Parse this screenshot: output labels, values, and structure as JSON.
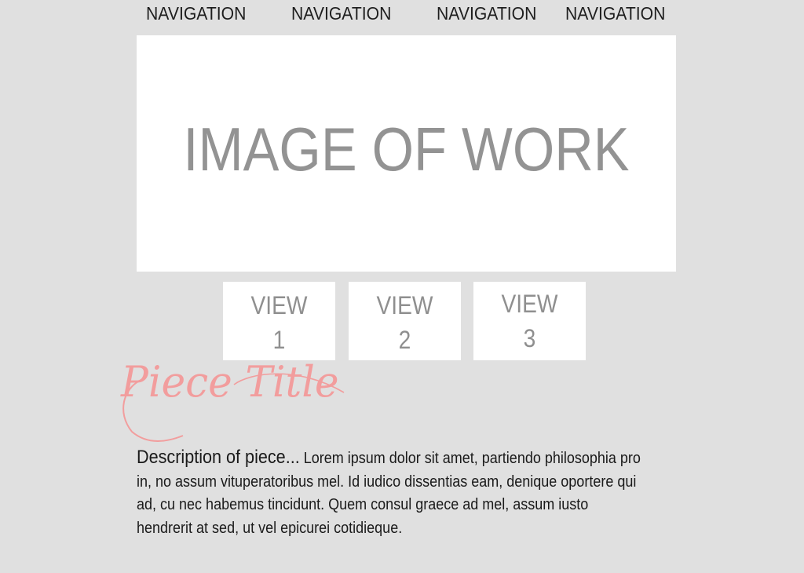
{
  "navigation": {
    "items": [
      {
        "label": "NAVIGATION"
      },
      {
        "label": "NAVIGATION"
      },
      {
        "label": "NAVIGATION"
      },
      {
        "label": "NAVIGATION"
      }
    ]
  },
  "hero": {
    "label": "IMAGE OF WORK"
  },
  "views": [
    {
      "word": "VIEW",
      "number": "1"
    },
    {
      "word": "VIEW",
      "number": "2"
    },
    {
      "word": "VIEW",
      "number": "3"
    }
  ],
  "piece": {
    "title": "Piece Title",
    "description_lead": "Description of piece...",
    "description_body": " Lorem ipsum dolor sit amet, partiendo philosophia pro in, no assum vituperatoribus mel. Id iudico dissentias eam, denique oportere qui ad, cu nec habemus tincidunt. Quem consul graece ad mel, assum iusto hendrerit at sed, ut vel epicurei cotidieque."
  },
  "colors": {
    "background": "#e0e0e0",
    "panel": "#ffffff",
    "placeholder_text": "#939393",
    "title_accent": "#f29d9d",
    "body_text": "#1a1a1a"
  }
}
